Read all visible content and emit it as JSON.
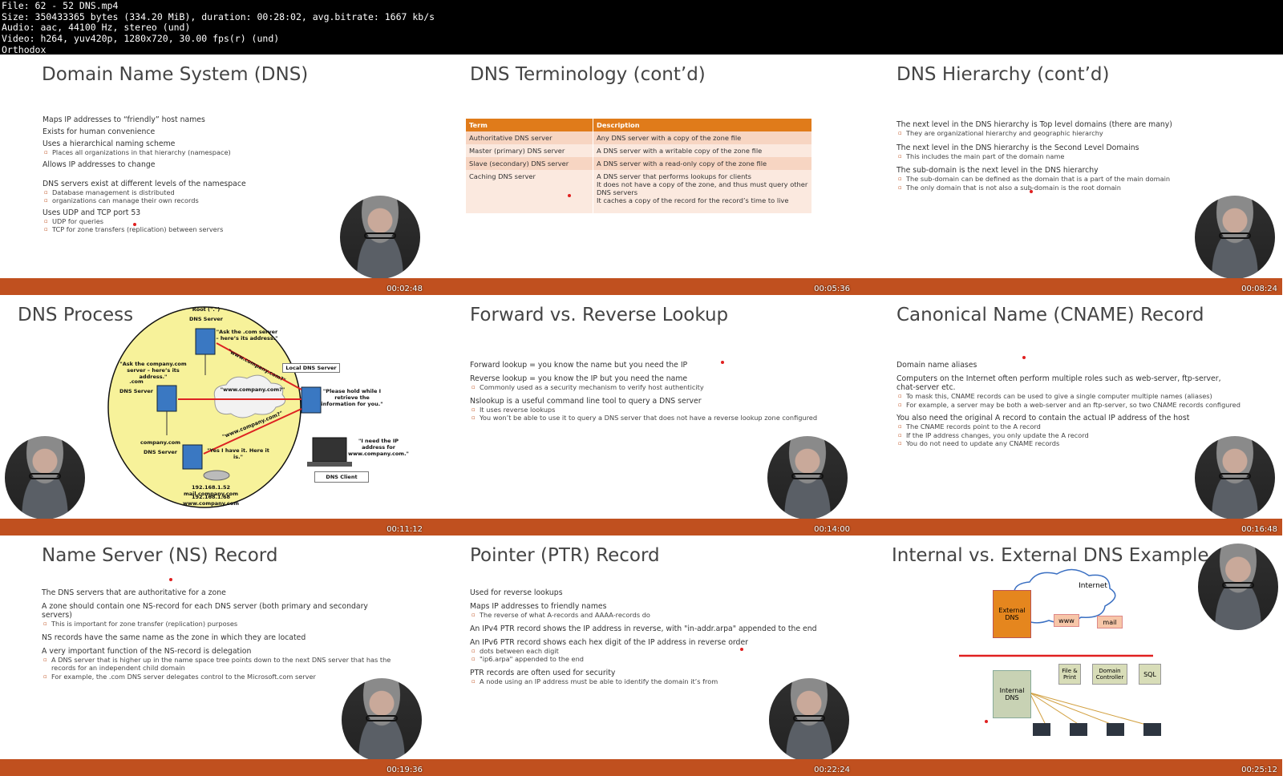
{
  "header": {
    "lines": [
      "File: 62 - 52 DNS.mp4",
      "Size: 350433365 bytes (334.20 MiB), duration: 00:28:02, avg.bitrate: 1667 kb/s",
      "Audio: aac, 44100 Hz, stereo (und)",
      "Video: h264, yuv420p, 1280x720, 30.00 fps(r) (und)",
      "Orthodox"
    ]
  },
  "colors": {
    "accent_bar": "#c0501f",
    "table_header": "#e07b1a"
  },
  "tiles": [
    {
      "title": "Domain Name System (DNS)",
      "timestamp": "00:02:48",
      "bullets": [
        {
          "t": "Maps IP addresses to “friendly” host names",
          "sub": []
        },
        {
          "t": "Exists for human convenience",
          "sub": []
        },
        {
          "t": "Uses a hierarchical naming scheme",
          "sub": [
            "Places all organizations in that hierarchy (namespace)"
          ]
        },
        {
          "t": "Allows IP addresses to change",
          "sub": []
        },
        {
          "t": "DNS servers exist at different levels of the namespace",
          "sub": [
            "Database management is distributed",
            "organizations can manage their own records"
          ]
        },
        {
          "t": "Uses UDP and TCP port 53",
          "sub": [
            "UDP for queries",
            "TCP for zone transfers (replication) between servers"
          ]
        }
      ]
    },
    {
      "title": "DNS Terminology (cont’d)",
      "timestamp": "00:05:36",
      "table": {
        "headers": [
          "Term",
          "Description"
        ],
        "rows": [
          [
            "Authoritative DNS server",
            "Any DNS server with a copy of the zone file"
          ],
          [
            "Master (primary) DNS server",
            "A DNS server with a writable copy of the zone file"
          ],
          [
            "Slave (secondary) DNS server",
            "A DNS server with a read-only copy of the zone file"
          ],
          [
            "Caching DNS server",
            "A DNS server that performs lookups for clients\nIt does not have a copy of the zone, and thus must query other DNS servers\nIt caches a copy of the record for the record’s time to live"
          ]
        ]
      }
    },
    {
      "title": "DNS Hierarchy (cont’d)",
      "timestamp": "00:08:24",
      "bullets": [
        {
          "t": "The next level in the DNS hierarchy is Top level domains (there are many)",
          "sub": [
            "They are organizational hierarchy and geographic hierarchy"
          ]
        },
        {
          "t": "The next level in the DNS hierarchy is the Second Level Domains",
          "sub": [
            "This includes the main part of the domain name"
          ]
        },
        {
          "t": "The sub-domain is the next level in the DNS hierarchy",
          "sub": [
            "The sub-domain can be defined as the domain that is a part of the main domain",
            "The only domain that is not also a sub-domain is the root domain"
          ]
        }
      ]
    },
    {
      "title": "DNS Process",
      "timestamp": "00:11:12",
      "diagram": {
        "root": "Root (\".\")",
        "dns_server": "DNS Server",
        "ask_com": "\"Ask the .com server – here’s its address.\"",
        "ask_company": "\"Ask the company.com server – here’s its address.\"",
        "com": ".com",
        "com_server": "DNS Server",
        "local": "Local DNS Server",
        "query1": "\"www.company.com?\"",
        "query2": "\"www.company.com?\"",
        "query3": "\"www.company.com?\"",
        "hold": "\"Please hold while I retrieve the information for you.\"",
        "company": "company.com",
        "company_server": "DNS Server",
        "yes": "\"Yes I have it. Here it is.\"",
        "rec1": "192.168.1.52 mail.company.com",
        "rec2": "192.168.1.68 www.company.com",
        "need": "\"I need the IP address for www.company.com.\"",
        "client": "DNS Client"
      }
    },
    {
      "title": "Forward vs. Reverse Lookup",
      "timestamp": "00:14:00",
      "bullets": [
        {
          "t": "Forward lookup = you know the name but you need the IP",
          "sub": []
        },
        {
          "t": "Reverse lookup = you know the IP but you need the name",
          "sub": [
            "Commonly used as a security mechanism to verify host authenticity"
          ]
        },
        {
          "t": "Nslookup is a useful command line tool to query a DNS server",
          "sub": [
            "It uses reverse lookups",
            "You won’t be able to use it to query a DNS server that does not have a reverse lookup zone configured"
          ]
        }
      ]
    },
    {
      "title": "Canonical Name (CNAME) Record",
      "timestamp": "00:16:48",
      "bullets": [
        {
          "t": "Domain name aliases",
          "sub": []
        },
        {
          "t": "Computers on the Internet often perform multiple roles such as web-server, ftp-server, chat-server etc.",
          "sub": [
            "To mask this, CNAME records can be used to give a single computer multiple names (aliases)",
            "For example, a server may be both a web-server and an ftp-server, so two CNAME records configured"
          ]
        },
        {
          "t": "You also need the original A record to contain the actual IP address of the host",
          "sub": [
            "The CNAME records point to the A record",
            "If the IP address changes, you only update the A record",
            "You do not need to update any CNAME records"
          ]
        }
      ]
    },
    {
      "title": "Name Server (NS) Record",
      "timestamp": "00:19:36",
      "bullets": [
        {
          "t": "The DNS servers that are authoritative for a zone",
          "sub": []
        },
        {
          "t": "A zone should contain one NS-record for each DNS server (both primary and secondary servers)",
          "sub": [
            "This is important for zone transfer (replication) purposes"
          ]
        },
        {
          "t": "NS records have the same name as the zone in which they are located",
          "sub": []
        },
        {
          "t": "A very important function of the NS-record is delegation",
          "sub": [
            "A DNS server that is higher up in the name space tree points down to the next DNS server that has the records for an independent child domain",
            "For example, the .com DNS server delegates control to the Microsoft.com server"
          ]
        }
      ]
    },
    {
      "title": "Pointer (PTR) Record",
      "timestamp": "00:22:24",
      "bullets": [
        {
          "t": "Used for reverse lookups",
          "sub": []
        },
        {
          "t": "Maps IP addresses to friendly names",
          "sub": [
            "The reverse of what A-records and AAAA-records do"
          ]
        },
        {
          "t": "An IPv4 PTR record shows the IP address in reverse, with \"in-addr.arpa\" appended to the end",
          "sub": []
        },
        {
          "t": "An IPv6 PTR record shows each hex digit of the IP address in reverse order",
          "sub": [
            "dots between each digit",
            "\"ip6.arpa\" appended to the end"
          ]
        },
        {
          "t": "PTR records are often used for security",
          "sub": [
            "A node using an IP address must be able to identify the domain it’s from"
          ]
        }
      ]
    },
    {
      "title": "Internal vs. External DNS Example",
      "timestamp": "00:25:12",
      "diagram": {
        "internet": "Internet",
        "external": "External DNS",
        "www": "www",
        "mail": "mail",
        "internal": "Internal DNS",
        "file": "File & Print",
        "dc": "Domain Controller",
        "sql": "SQL"
      }
    }
  ]
}
